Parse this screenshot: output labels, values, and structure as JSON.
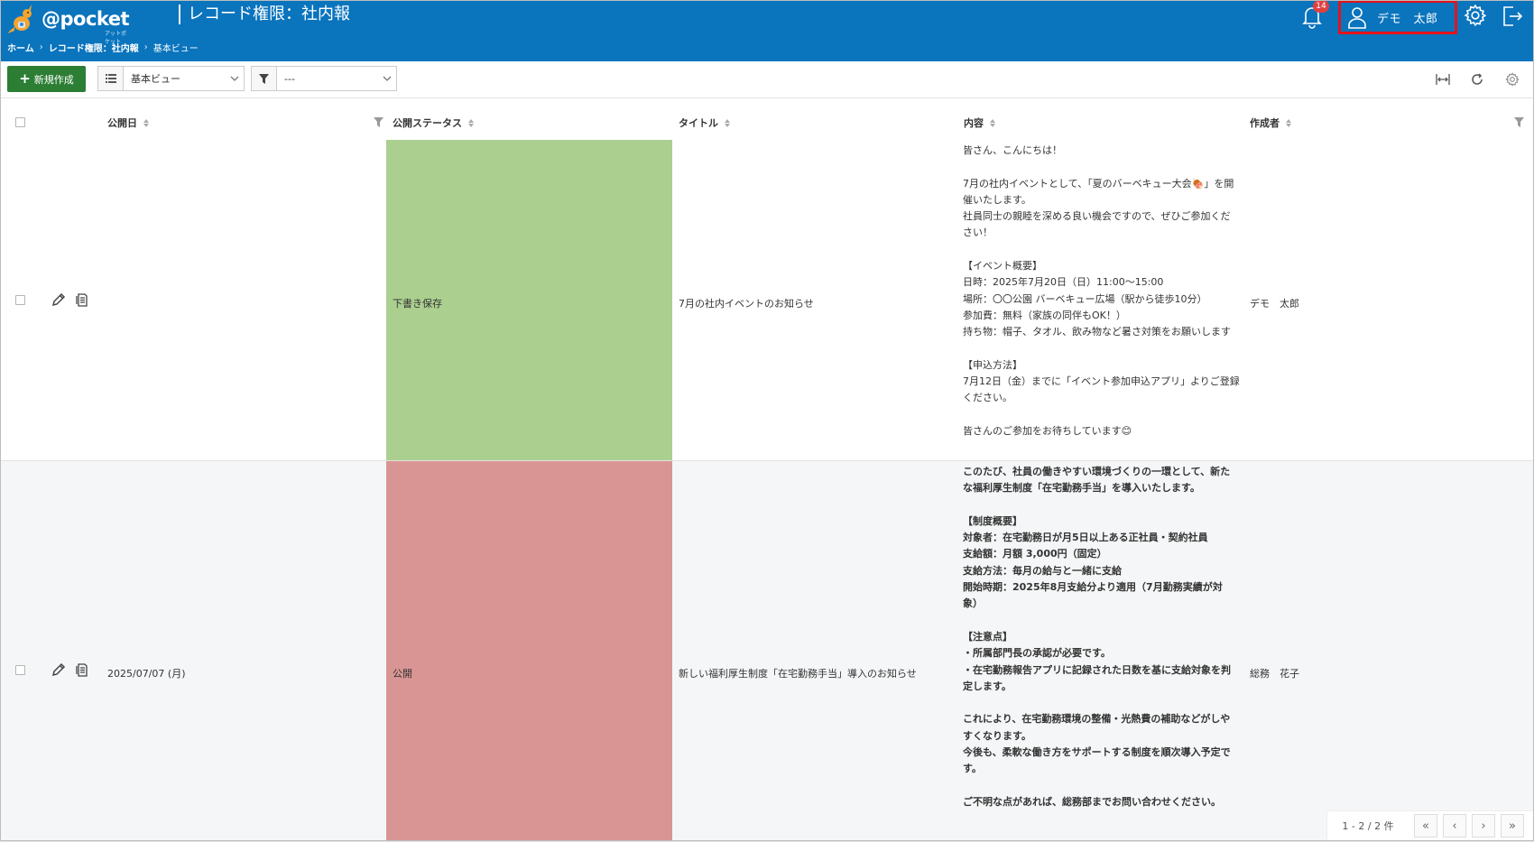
{
  "header": {
    "brand": "@pocket",
    "brand_tag": "アットポケット",
    "app_title": "レコード権限：社内報",
    "breadcrumb": [
      "ホーム",
      "レコード権限：社内報",
      "基本ビュー"
    ],
    "notification_count": "14",
    "user_name": "デモ　太郎"
  },
  "toolbar": {
    "new_label": "新規作成",
    "view_select": "基本ビュー",
    "filter_select": "---"
  },
  "columns": {
    "date": "公開日",
    "status": "公開ステータス",
    "title": "タイトル",
    "content": "内容",
    "author": "作成者"
  },
  "rows": [
    {
      "date": "",
      "status": "下書き保存",
      "status_color": "#abcf8f",
      "title": "7月の社内イベントのお知らせ",
      "content": "皆さん、こんにちは！\n\n7月の社内イベントとして、「夏のバーベキュー大会🍖」を開催いたします。\n社員同士の親睦を深める良い機会ですので、ぜひご参加ください！\n\n【イベント概要】\n日時：2025年7月20日（日）11:00～15:00\n場所：〇〇公園 バーベキュー広場（駅から徒歩10分）\n参加費：無料（家族の同伴もOK！）\n持ち物：帽子、タオル、飲み物など暑さ対策をお願いします\n\n【申込方法】\n7月12日（金）までに「イベント参加申込アプリ」よりご登録ください。\n\n皆さんのご参加をお待ちしています😊",
      "author": "デモ　太郎"
    },
    {
      "date": "2025/07/07 (月)",
      "status": "公開",
      "status_color": "#d99594",
      "title": "新しい福利厚生制度「在宅勤務手当」導入のお知らせ",
      "content": "このたび、社員の働きやすい環境づくりの一環として、新たな福利厚生制度「在宅勤務手当」を導入いたします。\n\n【制度概要】\n対象者：在宅勤務日が月5日以上ある正社員・契約社員\n支給額：月額 3,000円（固定）\n支給方法：毎月の給与と一緒に支給\n開始時期：2025年8月支給分より適用（7月勤務実績が対象）\n\n【注意点】\n・所属部門長の承認が必要です。\n・在宅勤務報告アプリに記録された日数を基に支給対象を判定します。\n\nこれにより、在宅勤務環境の整備・光熱費の補助などがしやすくなります。\n今後も、柔軟な働き方をサポートする制度を順次導入予定です。\n\nご不明な点があれば、総務部までお問い合わせください。",
      "author": "総務　花子"
    }
  ],
  "pager": {
    "info": "1 - 2 / 2 件"
  },
  "colors": {
    "header_bg": "#0a74bd",
    "new_button": "#2c7e34",
    "highlight_box": "#e3131b"
  }
}
